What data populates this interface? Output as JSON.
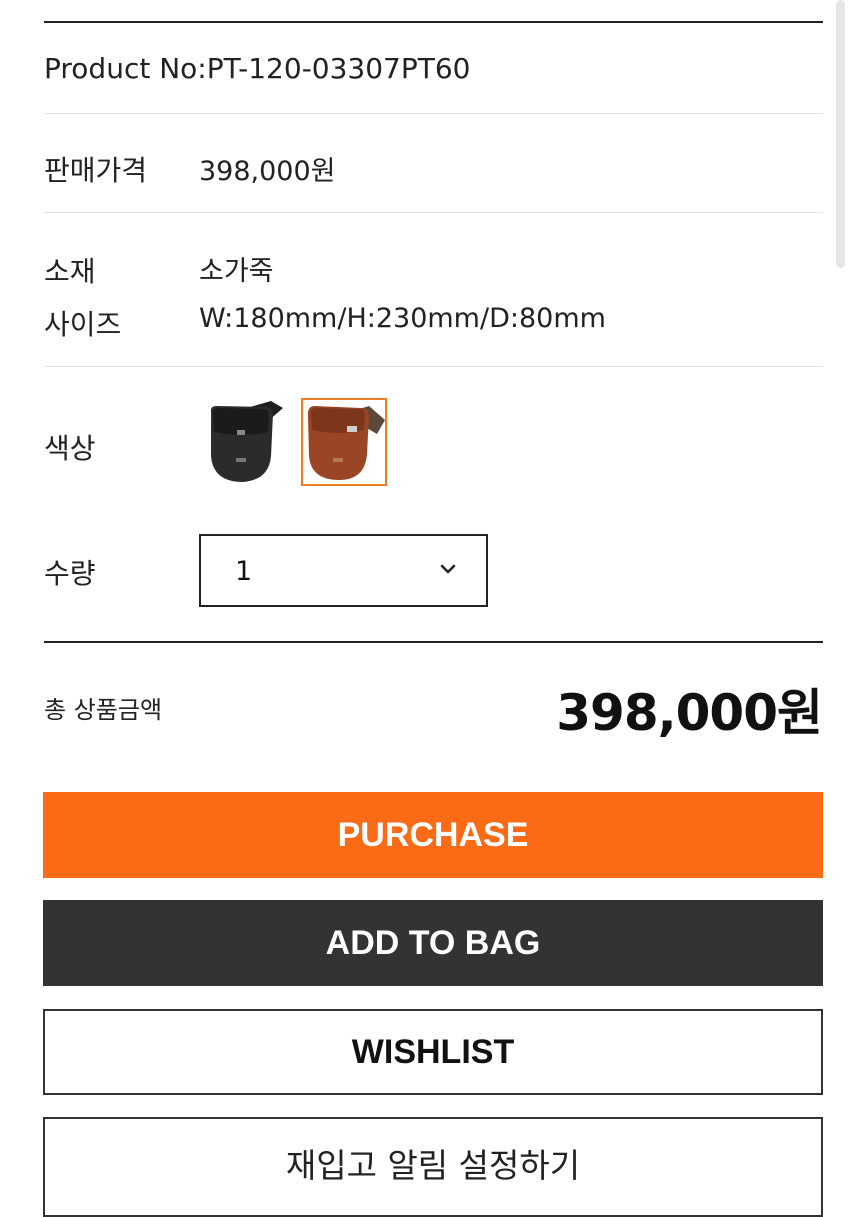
{
  "product": {
    "product_no": "Product No:PT-120-03307PT60"
  },
  "price_row": {
    "label": "판매가격",
    "value": "398,000원"
  },
  "specs": {
    "material_label": "소재",
    "material_value": "소가죽",
    "size_label": "사이즈",
    "size_value": "W:180mm/H:230mm/D:80mm"
  },
  "color_row": {
    "label": "색상",
    "options": [
      {
        "name": "black",
        "color": "#2b2b2b",
        "selected": false
      },
      {
        "name": "brown",
        "color": "#9a4626",
        "selected": true
      }
    ]
  },
  "quantity_row": {
    "label": "수량",
    "value": "1"
  },
  "total": {
    "label": "총 상품금액",
    "value": "398,000원"
  },
  "buttons": {
    "purchase": "PURCHASE",
    "add_to_bag": "ADD TO BAG",
    "wishlist": "WISHLIST",
    "restock": "재입고 알림 설정하기"
  },
  "colors": {
    "accent": "#fb6a14",
    "dark_button": "#333333",
    "swatch_selected_border": "#f07c24"
  }
}
